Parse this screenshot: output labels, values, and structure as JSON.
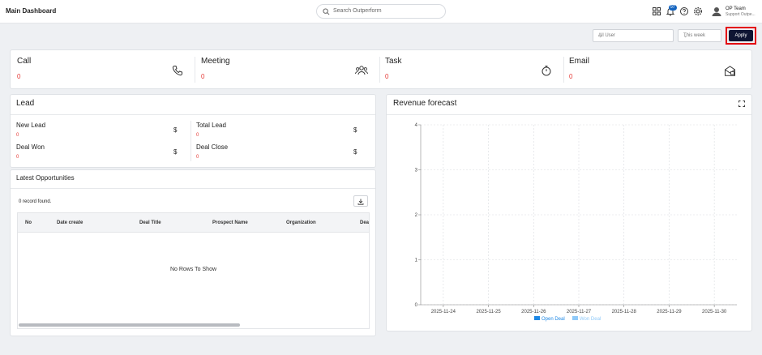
{
  "header": {
    "title": "Main Dashboard",
    "search_placeholder": "Search Outperform",
    "notification_count": "97",
    "user_name": "OP Team",
    "user_sub": "Support Outpe..."
  },
  "filters": {
    "user_select": "All User",
    "period_select": "This week",
    "apply_label": "Apply"
  },
  "stats": [
    {
      "label": "Call",
      "value": "0",
      "icon": "phone-icon"
    },
    {
      "label": "Meeting",
      "value": "0",
      "icon": "users-icon"
    },
    {
      "label": "Task",
      "value": "0",
      "icon": "stopwatch-icon"
    },
    {
      "label": "Email",
      "value": "0",
      "icon": "mail-open-icon"
    }
  ],
  "lead": {
    "title": "Lead",
    "items": [
      {
        "label": "New Lead",
        "value": "0",
        "unit": "$"
      },
      {
        "label": "Total Lead",
        "value": "0",
        "unit": "$"
      },
      {
        "label": "Deal Won",
        "value": "0",
        "unit": "$"
      },
      {
        "label": "Deal Close",
        "value": "0",
        "unit": "$"
      }
    ]
  },
  "opportunities": {
    "title": "Latest Opportunities",
    "record_text": "0 record found.",
    "columns": [
      "No",
      "Date create",
      "Deal Title",
      "Prospect Name",
      "Organization",
      "Dea"
    ],
    "empty_text": "No Rows To Show"
  },
  "revenue": {
    "title": "Revenue forecast"
  },
  "chart_data": {
    "type": "bar",
    "title": "Revenue forecast",
    "categories": [
      "2025-11-24",
      "2025-11-25",
      "2025-11-26",
      "2025-11-27",
      "2025-11-28",
      "2025-11-29",
      "2025-11-30"
    ],
    "series": [
      {
        "name": "Open Deal",
        "values": [
          0,
          0,
          0,
          0,
          0,
          0,
          0
        ],
        "color": "#1e88e5"
      },
      {
        "name": "Won Deal",
        "values": [
          0,
          0,
          0,
          0,
          0,
          0,
          0
        ],
        "color": "#90caf9"
      }
    ],
    "y_ticks": [
      "0",
      "1",
      "2",
      "3",
      "4"
    ],
    "ylim": [
      0,
      4
    ],
    "grid": true,
    "legend": "bottom"
  },
  "colors": {
    "accent": "#0f1533",
    "value_red": "#e53935",
    "highlight_border": "#e3000f"
  }
}
